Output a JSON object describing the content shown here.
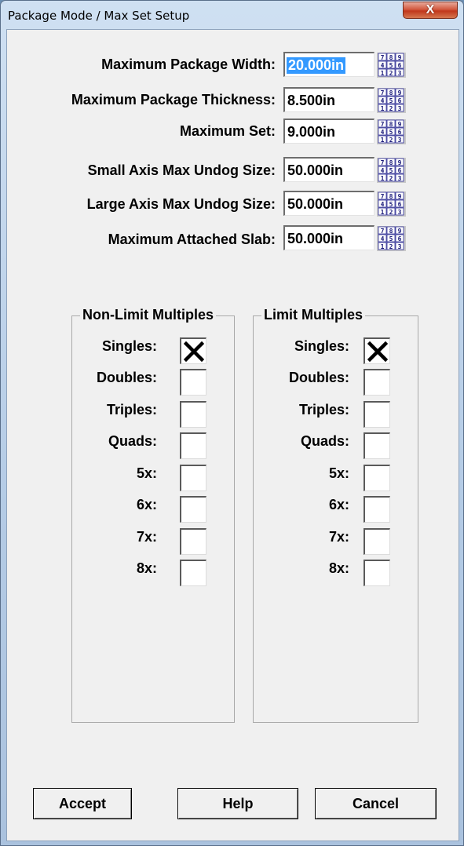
{
  "window": {
    "title": "Package Mode / Max Set Setup",
    "close_glyph": "X"
  },
  "fields": [
    {
      "label": "Maximum Package Width:",
      "value": "20.000in",
      "selected": true
    },
    {
      "label": "Maximum Package Thickness:",
      "value": "8.500in"
    },
    {
      "label": "Maximum Set:",
      "value": "9.000in"
    },
    {
      "label": "Small Axis Max Undog Size:",
      "value": "50.000in"
    },
    {
      "label": "Large Axis Max Undog Size:",
      "value": "50.000in"
    },
    {
      "label": "Maximum Attached Slab:",
      "value": "50.000in"
    }
  ],
  "keypad_icon": {
    "name": "numeric-keypad-icon",
    "digits": [
      "7",
      "8",
      "9",
      "4",
      "5",
      "6",
      "1",
      "2",
      "3"
    ]
  },
  "groups": {
    "non_limit": {
      "title": "Non-Limit Multiples",
      "items": [
        {
          "label": "Singles:",
          "checked": true
        },
        {
          "label": "Doubles:",
          "checked": false
        },
        {
          "label": "Triples:",
          "checked": false
        },
        {
          "label": "Quads:",
          "checked": false
        },
        {
          "label": "5x:",
          "checked": false
        },
        {
          "label": "6x:",
          "checked": false
        },
        {
          "label": "7x:",
          "checked": false
        },
        {
          "label": "8x:",
          "checked": false
        }
      ]
    },
    "limit": {
      "title": "Limit Multiples",
      "items": [
        {
          "label": "Singles:",
          "checked": true
        },
        {
          "label": "Doubles:",
          "checked": false
        },
        {
          "label": "Triples:",
          "checked": false
        },
        {
          "label": "Quads:",
          "checked": false
        },
        {
          "label": "5x:",
          "checked": false
        },
        {
          "label": "6x:",
          "checked": false
        },
        {
          "label": "7x:",
          "checked": false
        },
        {
          "label": "8x:",
          "checked": false
        }
      ]
    }
  },
  "buttons": {
    "accept": "Accept",
    "help": "Help",
    "cancel": "Cancel"
  }
}
